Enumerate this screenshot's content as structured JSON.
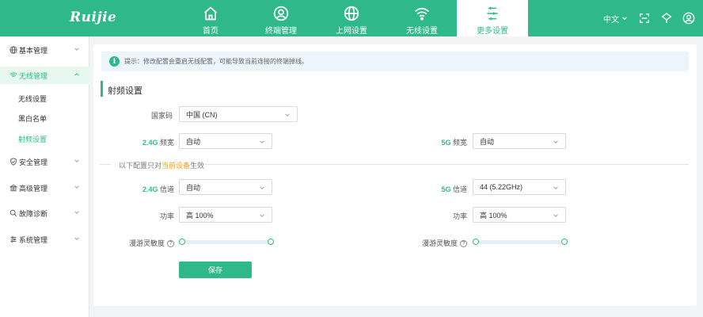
{
  "brand": {
    "logo_text": "Ruijie"
  },
  "nav": [
    {
      "label": "首页",
      "icon": "home-icon"
    },
    {
      "label": "终端管理",
      "icon": "user-icon"
    },
    {
      "label": "上网设置",
      "icon": "globe-icon"
    },
    {
      "label": "无线设置",
      "icon": "wifi-icon"
    },
    {
      "label": "更多设置",
      "icon": "sliders-icon",
      "active": true
    }
  ],
  "top_right": {
    "language": "中文"
  },
  "sidebar": {
    "items": [
      {
        "label": "基本管理",
        "icon": "globe-icon"
      },
      {
        "label": "无线管理",
        "icon": "wifi-icon",
        "open": true
      },
      {
        "label": "安全管理",
        "icon": "shield-icon"
      },
      {
        "label": "高级管理",
        "icon": "bank-icon"
      },
      {
        "label": "故障诊断",
        "icon": "magnifier-icon"
      },
      {
        "label": "系统管理",
        "icon": "settings-icon"
      }
    ],
    "sub_items": [
      {
        "label": "无线设置"
      },
      {
        "label": "黑白名单"
      },
      {
        "label": "射频设置",
        "active": true
      }
    ]
  },
  "tip": {
    "text": "提示：修改配置会重启无线配置，可能导致当前连接的终端掉线。"
  },
  "section": {
    "title": "射频设置"
  },
  "form": {
    "country_label": "国家码",
    "country_value": "中国 (CN)",
    "bw24_label_prefix": "2.4G",
    "bw24_label_suffix": " 频宽",
    "bw24_value": "自动",
    "bw5_label_prefix": "5G",
    "bw5_label_suffix": " 频宽",
    "bw5_value": "自动",
    "divider_text_a": "以下配置只对",
    "divider_text_hl": "当前设备",
    "divider_text_b": "生效",
    "ch24_label_prefix": "2.4G",
    "ch24_label_suffix": " 信道",
    "ch24_value": "自动",
    "ch5_label_prefix": "5G",
    "ch5_label_suffix": " 信道",
    "ch5_value": "44 (5.22GHz)",
    "power24_label": "功率",
    "power24_value": "高 100%",
    "power5_label": "功率",
    "power5_value": "高 100%",
    "roam24_label": "漫游灵敏度",
    "roam5_label": "漫游灵敏度",
    "save_label": "保存"
  },
  "colors": {
    "accent": "#2fb98a",
    "highlight": "#f0a020"
  }
}
